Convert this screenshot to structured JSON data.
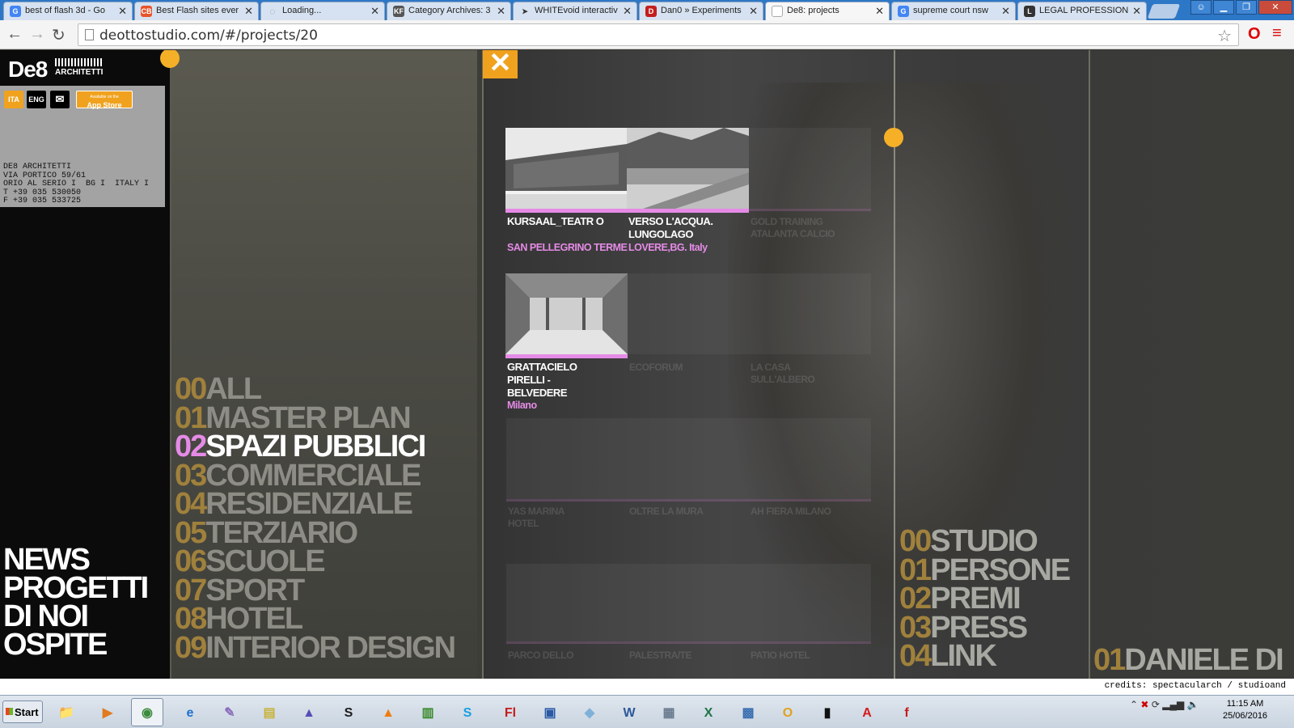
{
  "browser": {
    "tabs": [
      {
        "title": "best of flash 3d - Go",
        "favicon": "google-icon",
        "color": "#4285f4"
      },
      {
        "title": "Best Flash sites ever",
        "favicon": "site-icon",
        "color": "#e8542c"
      },
      {
        "title": "Loading...",
        "favicon": "loading-icon",
        "color": "#999999"
      },
      {
        "title": "Category Archives: 3",
        "favicon": "kf-icon",
        "color": "#555555"
      },
      {
        "title": "WHITEvoid interactiv",
        "favicon": "whitevoid-icon",
        "color": "#333333"
      },
      {
        "title": "Dan0 » Experiments",
        "favicon": "dan0-icon",
        "color": "#c41e1e"
      },
      {
        "title": "De8: projects",
        "favicon": "page-icon",
        "color": "#cccccc"
      },
      {
        "title": "supreme court nsw",
        "favicon": "google-icon",
        "color": "#4285f4"
      },
      {
        "title": "LEGAL PROFESSION",
        "favicon": "legal-icon",
        "color": "#333333"
      }
    ],
    "url": "deottostudio.com/#/projects/20"
  },
  "site": {
    "logo_main": "De8",
    "logo_sub": "ARCHITETTI",
    "lang_ita": "ITA",
    "lang_eng": "ENG",
    "appstore_small": "Available on the",
    "appstore_label": "App Store",
    "address": [
      "DE8 ARCHITETTI",
      "VIA PORTICO 59/61",
      "ORIO AL SERIO I  BG I  ITALY I",
      "T +39 035 530050",
      "F +39 035 533725"
    ],
    "main_nav": [
      "NEWS",
      "PROGETTI",
      "DI NOI",
      "OSPITE"
    ],
    "categories": [
      {
        "num": "00",
        "label": "ALL"
      },
      {
        "num": "01",
        "label": "MASTER PLAN"
      },
      {
        "num": "02",
        "label": "SPAZI PUBBLICI",
        "active": true
      },
      {
        "num": "03",
        "label": "COMMERCIALE"
      },
      {
        "num": "04",
        "label": "RESIDENZIALE"
      },
      {
        "num": "05",
        "label": "TERZIARIO"
      },
      {
        "num": "06",
        "label": "SCUOLE"
      },
      {
        "num": "07",
        "label": "SPORT"
      },
      {
        "num": "08",
        "label": "HOTEL"
      },
      {
        "num": "09",
        "label": "INTERIOR DESIGN"
      }
    ],
    "projects": [
      {
        "title": "KURSAAL_TEATR O",
        "location": "SAN PELLEGRINO TERME"
      },
      {
        "title": "VERSO L'ACQUA. LUNGOLAGO",
        "location": "LOVERE,BG. Italy"
      },
      {
        "title": "GRATTACIELO PIRELLI - BELVEDERE",
        "location": "Milano"
      }
    ],
    "ghost_projects": [
      "GOLD TRAINING ATALANTA CALCIO",
      "ECOFORUM",
      "LA CASA SULL'ALBERO",
      "YAS MARINA HOTEL",
      "OLTRE LA MURA",
      "AH FIERA MILANO",
      "PARCO DELLO",
      "PALESTRA/TE",
      "PATIO HOTEL"
    ],
    "right_nav": [
      {
        "num": "00",
        "label": "STUDIO"
      },
      {
        "num": "01",
        "label": "PERSONE"
      },
      {
        "num": "02",
        "label": "PREMI"
      },
      {
        "num": "03",
        "label": "PRESS"
      },
      {
        "num": "04",
        "label": "LINK"
      }
    ],
    "person": {
      "num": "01",
      "label": "DANIELE DI"
    },
    "credits": "credits: spectacularch / studioand",
    "accent_pink": "#e58be6",
    "accent_orange": "#f0a21f"
  },
  "taskbar": {
    "start_label": "Start",
    "apps": [
      "explorer-icon",
      "media-icon",
      "chrome-icon",
      "ie-icon",
      "paint-icon",
      "notes-icon",
      "wizard-icon",
      "snagit-icon",
      "vlc-icon",
      "chart-icon",
      "skype-icon",
      "flash-icon",
      "remote-icon",
      "eraser-icon",
      "word-icon",
      "calculator-icon",
      "excel-icon",
      "network-icon",
      "outlook-icon",
      "cmd-icon",
      "acrobat-icon",
      "flashplayer-icon"
    ],
    "time": "11:15 AM",
    "date": "25/06/2016"
  }
}
